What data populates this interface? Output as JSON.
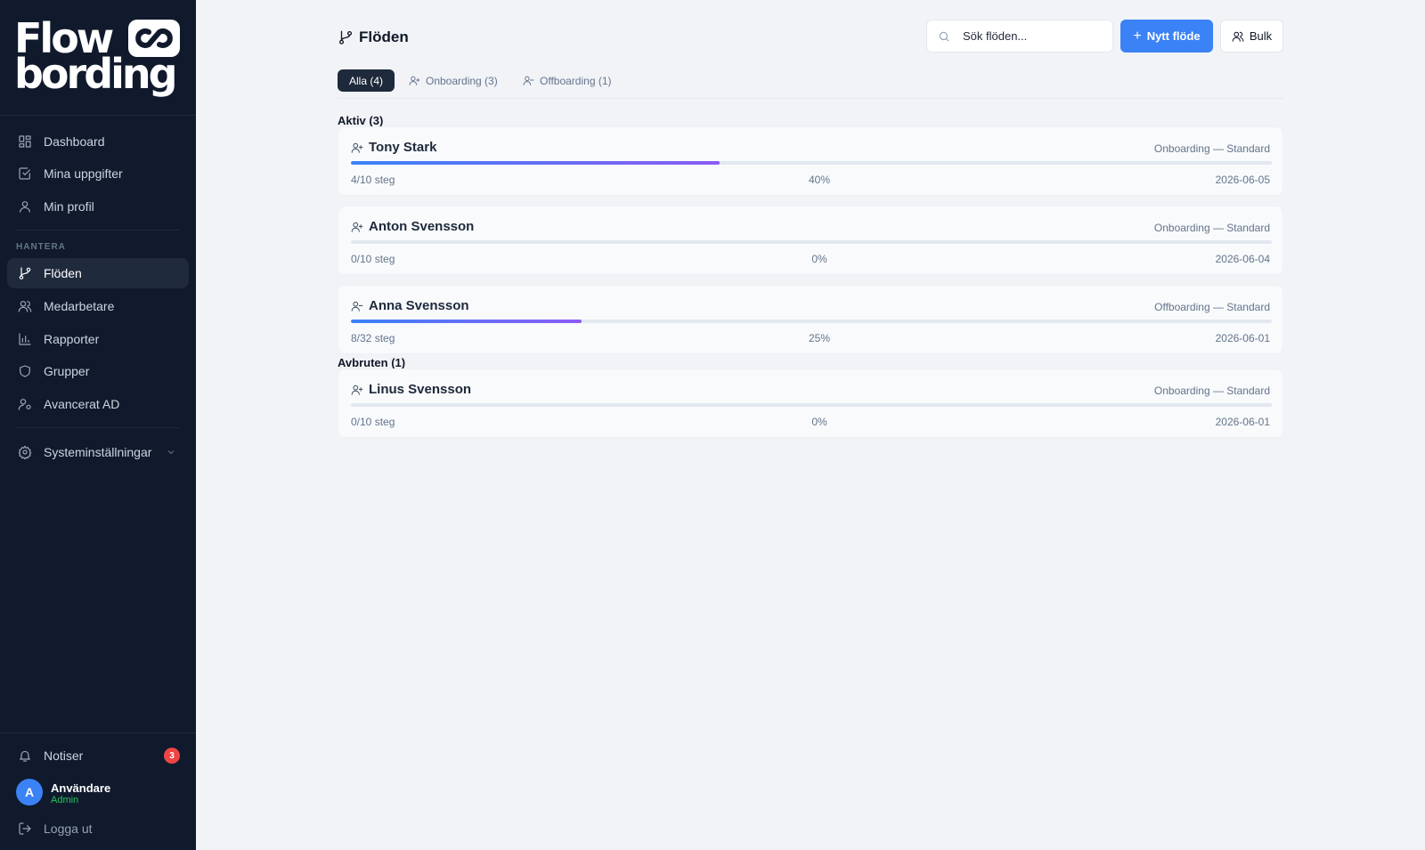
{
  "sidebar": {
    "logo": {
      "line1": "Flow",
      "line2": "bording"
    },
    "nav": [
      {
        "label": "Dashboard",
        "icon": "dashboard-icon"
      },
      {
        "label": "Mina uppgifter",
        "icon": "checkbox-icon"
      },
      {
        "label": "Min profil",
        "icon": "user-icon"
      }
    ],
    "section_label": "HANTERA",
    "manage": [
      {
        "label": "Flöden",
        "icon": "branch-icon",
        "active": true
      },
      {
        "label": "Medarbetare",
        "icon": "users-icon"
      },
      {
        "label": "Rapporter",
        "icon": "bar-chart-icon"
      },
      {
        "label": "Grupper",
        "icon": "shield-icon"
      },
      {
        "label": "Avancerat AD",
        "icon": "user-gear-icon"
      }
    ],
    "settings_label": "Systeminställningar",
    "notifications_label": "Notiser",
    "notifications_count": "3",
    "user": {
      "initial": "A",
      "name": "Användare",
      "role": "Admin"
    },
    "logout_label": "Logga ut"
  },
  "header": {
    "title": "Flöden",
    "search_placeholder": "Sök flöden...",
    "new_button": "Nytt flöde",
    "bulk_button": "Bulk"
  },
  "tabs": [
    {
      "label": "Alla (4)",
      "active": true
    },
    {
      "label": "Onboarding (3)"
    },
    {
      "label": "Offboarding (1)"
    }
  ],
  "groups": {
    "active": {
      "title": "Aktiv (3)",
      "flows": [
        {
          "name": "Tony Stark",
          "type": "Onboarding — Standard",
          "steps": "4/10 steg",
          "percent": "40%",
          "progress": 0.4,
          "date": "2026-06-05"
        },
        {
          "name": "Anton Svensson",
          "type": "Onboarding — Standard",
          "steps": "0/10 steg",
          "percent": "0%",
          "progress": 0.0,
          "date": "2026-06-04"
        },
        {
          "name": "Anna Svensson",
          "type": "Offboarding — Standard",
          "steps": "8/32 steg",
          "percent": "25%",
          "progress": 0.25,
          "date": "2026-06-01"
        }
      ]
    },
    "cancelled": {
      "title": "Avbruten (1)",
      "flows": [
        {
          "name": "Linus Svensson",
          "type": "Onboarding — Standard",
          "steps": "0/10 steg",
          "percent": "0%",
          "progress": 0.0,
          "date": "2026-06-01"
        }
      ]
    }
  },
  "colors": {
    "accent": "#3b82f6",
    "progress_end": "#8b5cf6",
    "sidebar_bg": "#101a2c",
    "badge": "#ef4444"
  }
}
